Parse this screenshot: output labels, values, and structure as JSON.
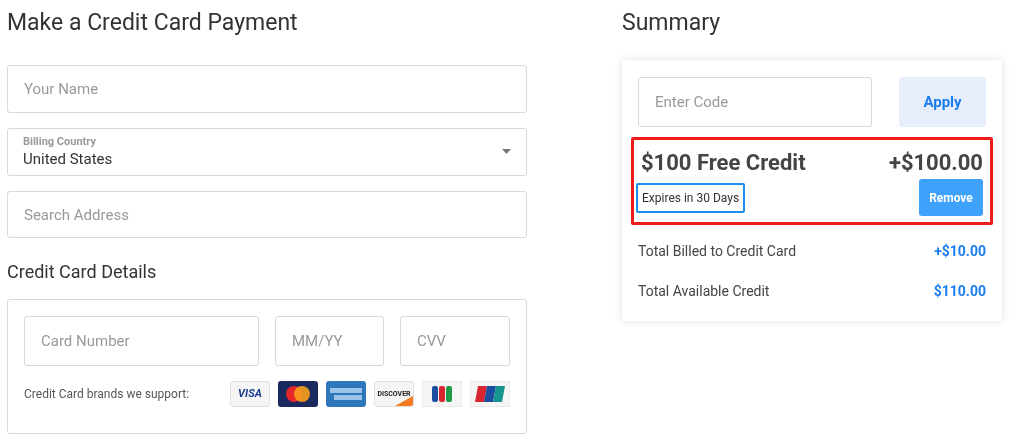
{
  "payment": {
    "title": "Make a Credit Card Payment",
    "name_field": {
      "placeholder": "Your Name"
    },
    "country_select": {
      "label": "Billing Country",
      "value": "United States"
    },
    "address_field": {
      "placeholder": "Search Address"
    },
    "card_section": {
      "title": "Credit Card Details",
      "card_number": {
        "placeholder": "Card Number"
      },
      "expiry": {
        "placeholder": "MM/YY"
      },
      "cvv": {
        "placeholder": "CVV"
      },
      "brands_label": "Credit Card brands we support:",
      "brands": [
        {
          "kind": "visa",
          "label": "VISA"
        },
        {
          "kind": "mastercard"
        },
        {
          "kind": "amex"
        },
        {
          "kind": "discover",
          "label": "DISCOVER"
        },
        {
          "kind": "jcb"
        },
        {
          "kind": "unionpay"
        }
      ]
    }
  },
  "summary": {
    "title": "Summary",
    "code_field": {
      "placeholder": "Enter Code"
    },
    "apply_button": "Apply",
    "credit": {
      "title": "$100 Free Credit",
      "amount": "+$100.00",
      "expiry": "Expires in 30 Days",
      "highlighted": true,
      "expiry_highlighted": true,
      "remove_button": "Remove"
    },
    "rows": [
      {
        "label": "Total Billed to Credit Card",
        "value": "+$10.00"
      },
      {
        "label": "Total Available Credit",
        "value": "$110.00"
      }
    ]
  }
}
